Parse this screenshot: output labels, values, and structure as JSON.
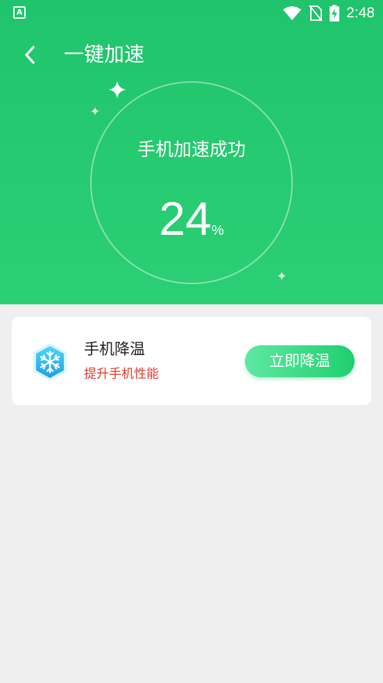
{
  "status_bar": {
    "app_icon_letter": "A",
    "time": "2:48",
    "icons": [
      "wifi-icon",
      "no-sim-icon",
      "battery-charging-icon"
    ]
  },
  "toolbar": {
    "title": "一键加速",
    "back_icon": "chevron-left-icon"
  },
  "result": {
    "message": "手机加速成功",
    "percent_value": "24",
    "percent_unit": "%"
  },
  "cooling_card": {
    "icon": "snowflake-icon",
    "title": "手机降温",
    "subtitle": "提升手机性能",
    "button_label": "立即降温"
  },
  "colors": {
    "hero_green": "#1fc46c",
    "accent_red": "#e23b2e",
    "button_gradient_start": "#5ee8a3",
    "button_gradient_end": "#1fcf6e",
    "page_background": "#efefef"
  }
}
